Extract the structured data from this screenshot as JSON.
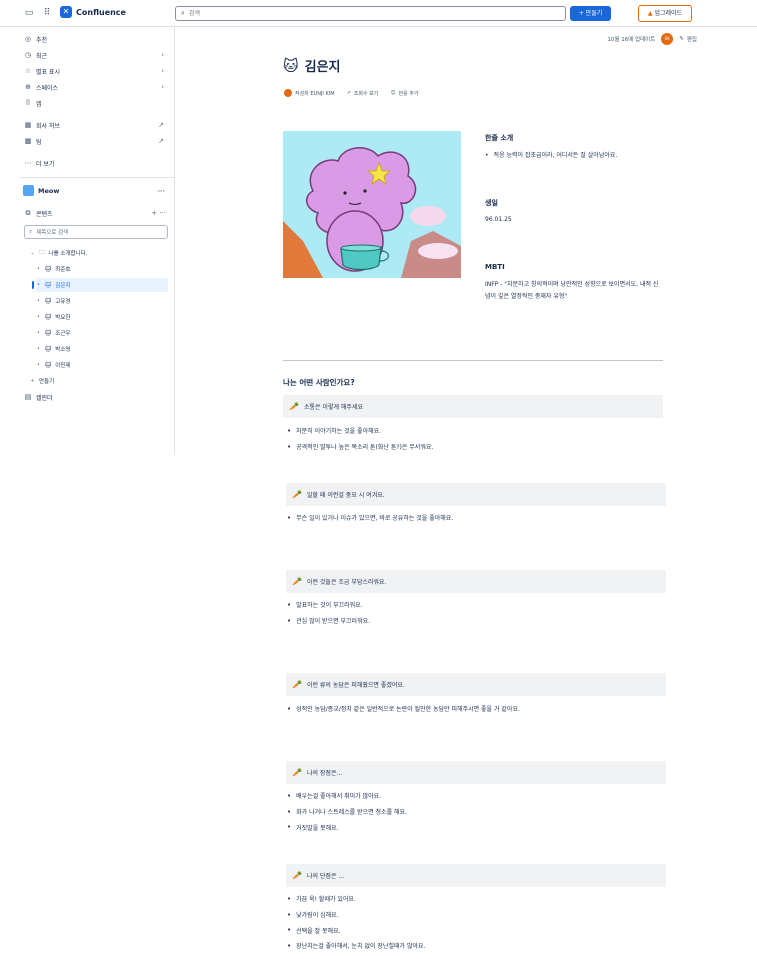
{
  "topbar": {
    "brand": "Confluence",
    "search_placeholder": "검색",
    "create_label": "+ 만들기",
    "upgrade_label": "업그레이드"
  },
  "sidebar": {
    "nav": [
      {
        "label": "추천",
        "icon": "compass-icon"
      },
      {
        "label": "최근",
        "icon": "clock-icon"
      },
      {
        "label": "별표 표시",
        "icon": "star-icon"
      },
      {
        "label": "스페이스",
        "icon": "globe-icon"
      },
      {
        "label": "앱",
        "icon": "apps-icon"
      }
    ],
    "hub": [
      {
        "label": "회사 허브",
        "icon": "building-icon"
      },
      {
        "label": "팀",
        "icon": "team-icon"
      }
    ],
    "more_label": "더 보기",
    "space_name": "Meow",
    "content_label": "콘텐츠",
    "tree_search_placeholder": "제목으로 검색",
    "tree_parent": "나를 소개합니다.",
    "tree_children": [
      "최준호",
      "김은지",
      "고유경",
      "박요한",
      "조근우",
      "박소영",
      "이민제"
    ],
    "create_label": "만들기",
    "calendar_label": "캘린더"
  },
  "page": {
    "updated": "10월 16에 업데이트",
    "avatar_initials": "EK",
    "edit_label": "편집",
    "emoji": "🐱",
    "title": "김은지",
    "author": "작성자 EUNJI KIM",
    "views": "조회수 보기",
    "reactions": "반응 추가",
    "intro_head": "한줄 소개",
    "intro_text": "적응 능력이 잡초급이라, 어디서든 잘 살아남아요.",
    "birth_head": "생일",
    "birth_text": "96.01.25",
    "mbti_head": "MBTI",
    "mbti_text": "INFP - \"차분하고 창의적이며 낭만적인 성향으로 보이면서도, 내적 신념이 깊은 열정적인 중재자 유형\"",
    "section_title": "나는 어떤 사람인가요?",
    "panels": [
      {
        "title": "소통은 이렇게 해주세요",
        "items": [
          "차분히 이야기하는 것을 좋아해요.",
          "공격적인 말투나 높은 목소리 톤(화난 톤?)은 무서워요."
        ]
      },
      {
        "title": "일할 때 이런걸 중요 시 여겨요.",
        "items": [
          "무슨 일이 있거나 이슈가 있으면, 바로 공유하는 것을 좋아해요."
        ]
      },
      {
        "title": "이런 것들은 조금 부담스러워요.",
        "items": [
          "발표하는 것이 부끄러워요.",
          "관심 많이 받으면 부끄러워요."
        ]
      },
      {
        "title": "이런 류의 농담은 피해줬으면 좋겠어요.",
        "items": [
          "성적인 농담/종교/정치 같은 일반적으로 논란이 될만한 농담만 피해주시면 좋을 거 같아요."
        ]
      },
      {
        "title": "나의 장점은...",
        "items": [
          "배우는걸 좋아해서 취미가 많아요.",
          "화가 나거나 스트레스를 받으면 청소를 해요.",
          "거짓말을 못해요."
        ]
      },
      {
        "title": "나의 단점은 ...",
        "items": [
          "가끔 욱! 할때가 있어요.",
          "낯가림이 심해요.",
          "선택을 잘 못해요.",
          "장난치는걸 좋아해서, 눈치 없이 장난칠때가 많아요."
        ]
      }
    ]
  },
  "colors": {
    "accent": "#1868db",
    "upgrade": "#e56910",
    "panel_bg": "#f1f2f4"
  }
}
